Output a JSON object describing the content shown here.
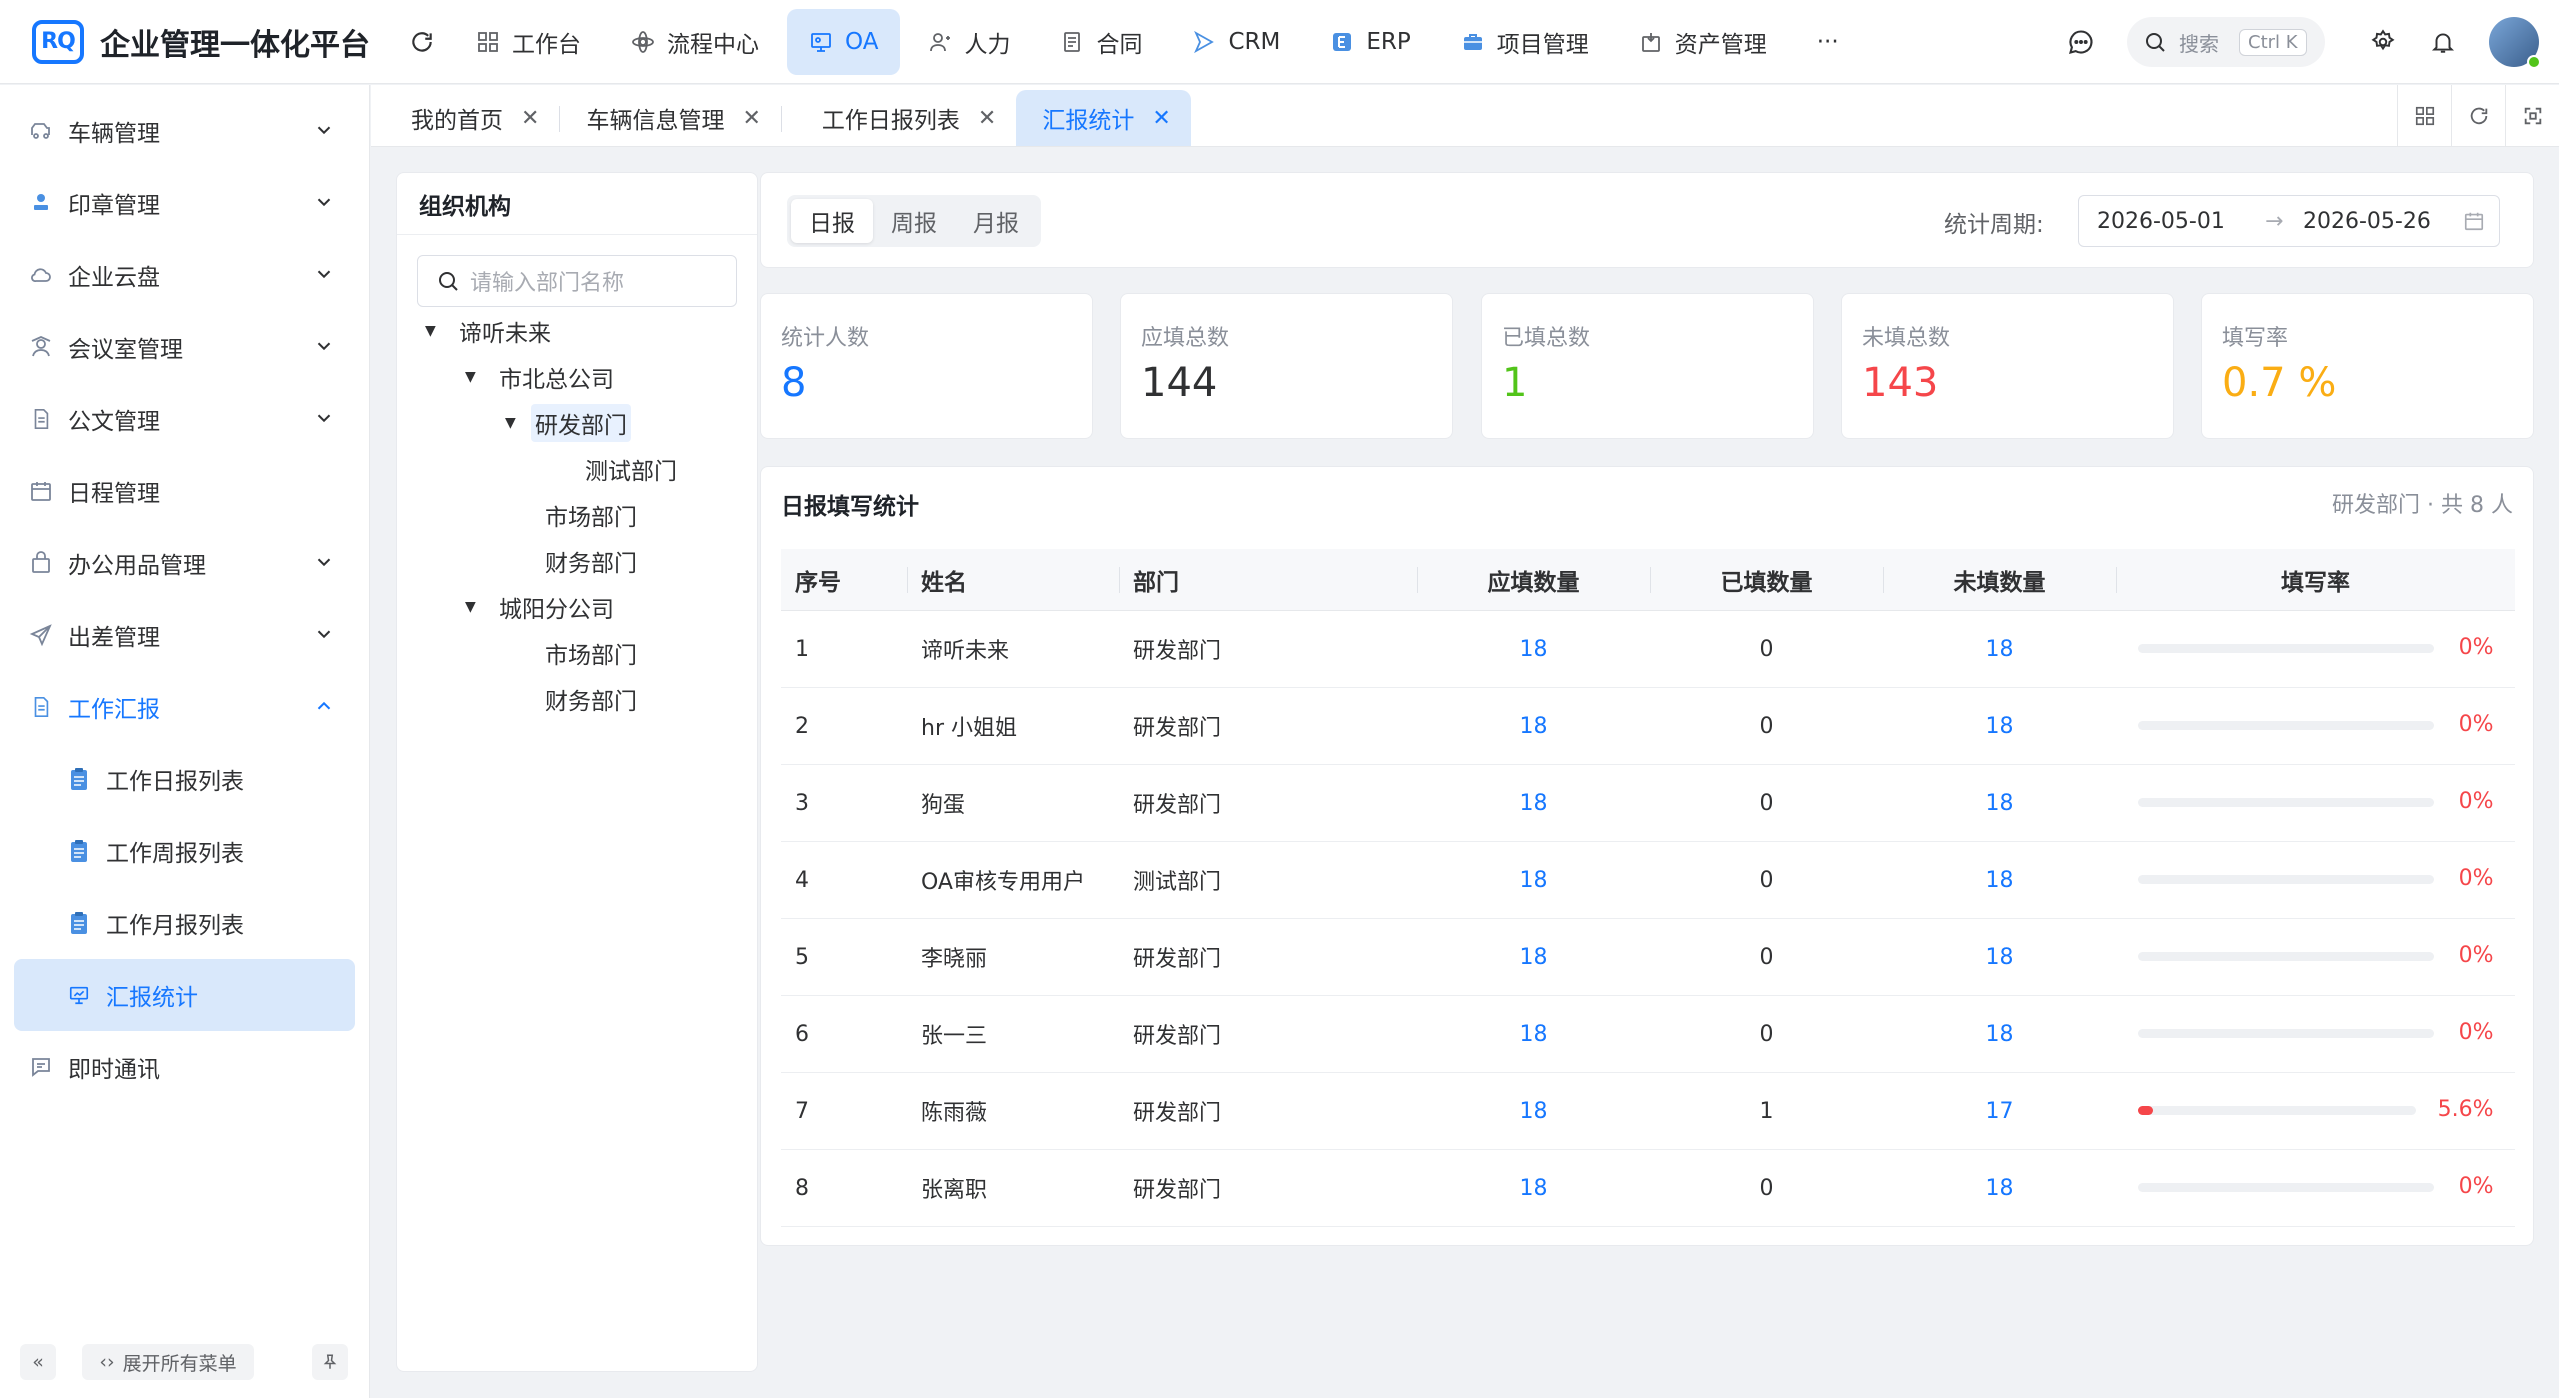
{
  "header": {
    "logo_text": "RQ",
    "app_title": "企业管理一体化平台",
    "nav": [
      {
        "label": "工作台",
        "icon": "dashboard-icon",
        "active": false
      },
      {
        "label": "流程中心",
        "icon": "flow-icon",
        "active": false
      },
      {
        "label": "OA",
        "icon": "oa-icon",
        "active": true
      },
      {
        "label": "人力",
        "icon": "user-icon",
        "active": false
      },
      {
        "label": "合同",
        "icon": "contract-icon",
        "active": false
      },
      {
        "label": "CRM",
        "icon": "crm-icon",
        "active": false
      },
      {
        "label": "ERP",
        "icon": "erp-icon",
        "active": false
      },
      {
        "label": "项目管理",
        "icon": "briefcase-icon",
        "active": false
      },
      {
        "label": "资产管理",
        "icon": "asset-icon",
        "active": false
      }
    ],
    "more": "···",
    "search_placeholder": "搜索",
    "search_shortcut": "Ctrl K"
  },
  "sidebar": {
    "items": [
      {
        "label": "车辆管理",
        "icon": "car-icon"
      },
      {
        "label": "印章管理",
        "icon": "stamp-icon"
      },
      {
        "label": "企业云盘",
        "icon": "cloud-icon"
      },
      {
        "label": "会议室管理",
        "icon": "meeting-icon"
      },
      {
        "label": "公文管理",
        "icon": "document-icon"
      },
      {
        "label": "日程管理",
        "icon": "calendar-icon"
      },
      {
        "label": "办公用品管理",
        "icon": "bag-icon"
      },
      {
        "label": "出差管理",
        "icon": "plane-icon"
      },
      {
        "label": "工作汇报",
        "icon": "report-icon"
      }
    ],
    "sub_items": [
      {
        "label": "工作日报列表"
      },
      {
        "label": "工作周报列表"
      },
      {
        "label": "工作月报列表"
      },
      {
        "label": "汇报统计"
      }
    ],
    "last_item": {
      "label": "即时通讯",
      "icon": "chat-icon"
    },
    "footer": {
      "collapse": "«",
      "expand_all": "展开所有菜单"
    }
  },
  "tabs": [
    {
      "label": "我的首页"
    },
    {
      "label": "车辆信息管理"
    },
    {
      "label": "工作日报列表"
    },
    {
      "label": "汇报统计"
    }
  ],
  "org": {
    "title": "组织机构",
    "search_placeholder": "请输入部门名称",
    "tree": [
      {
        "label": "谛听未来"
      },
      {
        "label": "市北总公司"
      },
      {
        "label": "研发部门"
      },
      {
        "label": "测试部门"
      },
      {
        "label": "市场部门"
      },
      {
        "label": "财务部门"
      },
      {
        "label": "城阳分公司"
      },
      {
        "label": "市场部门"
      },
      {
        "label": "财务部门"
      }
    ]
  },
  "filter": {
    "periods": [
      "日报",
      "周报",
      "月报"
    ],
    "period_label": "统计周期:",
    "start_date": "2026-05-01",
    "end_date": "2026-05-26",
    "range_sep": "→"
  },
  "stats": [
    {
      "label": "统计人数",
      "value": "8",
      "color": "#1677ff"
    },
    {
      "label": "应填总数",
      "value": "144",
      "color": "#303133"
    },
    {
      "label": "已填总数",
      "value": "1",
      "color": "#52c41a"
    },
    {
      "label": "未填总数",
      "value": "143",
      "color": "#f5464a"
    },
    {
      "label": "填写率",
      "value": "0.7 %",
      "color": "#faad14"
    }
  ],
  "table": {
    "title": "日报填写统计",
    "subtitle": "研发部门 · 共 8 人",
    "columns": [
      "序号",
      "姓名",
      "部门",
      "应填数量",
      "已填数量",
      "未填数量",
      "填写率"
    ],
    "rows": [
      {
        "idx": "1",
        "name": "谛听未来",
        "dept": "研发部门",
        "due": "18",
        "done": "0",
        "undone": "18",
        "rate": "0%",
        "rate_value": 0
      },
      {
        "idx": "2",
        "name": "hr 小姐姐",
        "dept": "研发部门",
        "due": "18",
        "done": "0",
        "undone": "18",
        "rate": "0%",
        "rate_value": 0
      },
      {
        "idx": "3",
        "name": "狗蛋",
        "dept": "研发部门",
        "due": "18",
        "done": "0",
        "undone": "18",
        "rate": "0%",
        "rate_value": 0
      },
      {
        "idx": "4",
        "name": "OA审核专用用户",
        "dept": "测试部门",
        "due": "18",
        "done": "0",
        "undone": "18",
        "rate": "0%",
        "rate_value": 0
      },
      {
        "idx": "5",
        "name": "李晓丽",
        "dept": "研发部门",
        "due": "18",
        "done": "0",
        "undone": "18",
        "rate": "0%",
        "rate_value": 0
      },
      {
        "idx": "6",
        "name": "张一三",
        "dept": "研发部门",
        "due": "18",
        "done": "0",
        "undone": "18",
        "rate": "0%",
        "rate_value": 0
      },
      {
        "idx": "7",
        "name": "陈雨薇",
        "dept": "研发部门",
        "due": "18",
        "done": "1",
        "undone": "17",
        "rate": "5.6%",
        "rate_value": 5.6
      },
      {
        "idx": "8",
        "name": "张离职",
        "dept": "研发部门",
        "due": "18",
        "done": "0",
        "undone": "18",
        "rate": "0%",
        "rate_value": 0
      }
    ]
  }
}
